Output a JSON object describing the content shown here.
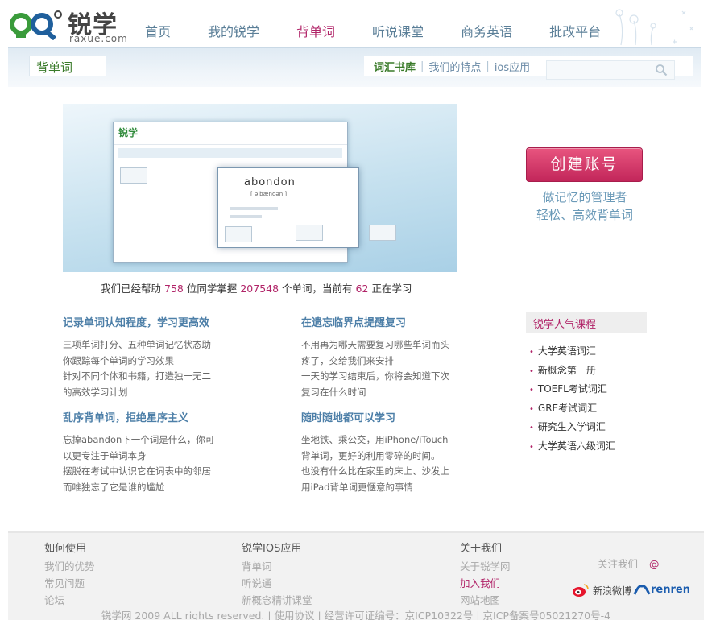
{
  "header": {
    "logo_text": "锐学",
    "logo_domain": "raxue.com",
    "nav": [
      {
        "label": "首页",
        "active": false
      },
      {
        "label": "我的锐学",
        "active": false
      },
      {
        "label": "背单词",
        "active": true
      },
      {
        "label": "听说课堂",
        "active": false
      },
      {
        "label": "商务英语",
        "active": false
      },
      {
        "label": "批改平台",
        "active": false
      }
    ]
  },
  "subbar": {
    "section_label": "背单词",
    "tabs": [
      {
        "label": "词汇书库",
        "active": true
      },
      {
        "label": "我们的特点",
        "active": false
      },
      {
        "label": "ios应用",
        "active": false
      }
    ],
    "search_placeholder": ""
  },
  "hero": {
    "preview_logo": "锐学",
    "preview_word": "abondon",
    "preview_phonetic": "[ əˈbændən ]"
  },
  "stats": {
    "prefix": "我们已经帮助",
    "users": "758",
    "mid1": "位同学掌握",
    "words": "207548",
    "mid2": "个单词，当前有",
    "online": "62",
    "suffix": "正在学习"
  },
  "cta": {
    "button_label": "创建账号",
    "tagline_line1": "做记忆的管理者",
    "tagline_line2": "轻松、高效背单词"
  },
  "features": [
    {
      "title": "记录单词认知程度，学习更高效",
      "lines": [
        "三项单词打分、五种单词记忆状态助",
        "你跟踪每个单词的学习效果",
        "针对不同个体和书籍，打造独一无二",
        "的高效学习计划"
      ]
    },
    {
      "title": "在遗忘临界点提醒复习",
      "lines": [
        "不用再为哪天需要复习哪些单词而头",
        "疼了，交给我们来安排",
        "一天的学习结束后，你将会知道下次",
        "复习在什么时间"
      ]
    },
    {
      "title": "乱序背单词，拒绝星序主义",
      "lines": [
        "忘掉abandon下一个词是什么，你可",
        "以更专注于单词本身",
        "摆脱在考试中认识它在词表中的邻居",
        "而唯独忘了它是谁的尴尬"
      ]
    },
    {
      "title": "随时随地都可以学习",
      "lines": [
        "坐地铁、乘公交，用iPhone/iTouch",
        "背单词，更好的利用零碎的时间。",
        "也没有什么比在家里的床上、沙发上",
        "用iPad背单词更惬意的事情"
      ]
    }
  ],
  "popular": {
    "title": "锐学人气课程",
    "items": [
      "大学英语词汇",
      "新概念第一册",
      "TOEFL考试词汇",
      "GRE考试词汇",
      "研究生入学词汇",
      "大学英语六级词汇"
    ]
  },
  "footer": {
    "col1": {
      "title": "如何使用",
      "links": [
        "我们的优势",
        "常见问题",
        "论坛"
      ]
    },
    "col2": {
      "title": "锐学IOS应用",
      "links": [
        "背单词",
        "听说通",
        "新概念精讲课堂"
      ]
    },
    "col3": {
      "title": "关于我们",
      "links": [
        "关于锐学网",
        "加入我们",
        "网站地图"
      ]
    },
    "follow_label": "关注我们",
    "follow_at": "@",
    "weibo_label": "新浪微博",
    "renren_label": "renren",
    "copyright": "锐学网 2009 ALL rights reserved. | 使用协议 | 经营许可证编号：京ICP10322号 | 京ICP备案号05021270号-4"
  },
  "colors": {
    "accent": "#b12468",
    "nav": "#5b7f98",
    "green": "#3a7b2a",
    "feature_title": "#4d7fa8"
  }
}
